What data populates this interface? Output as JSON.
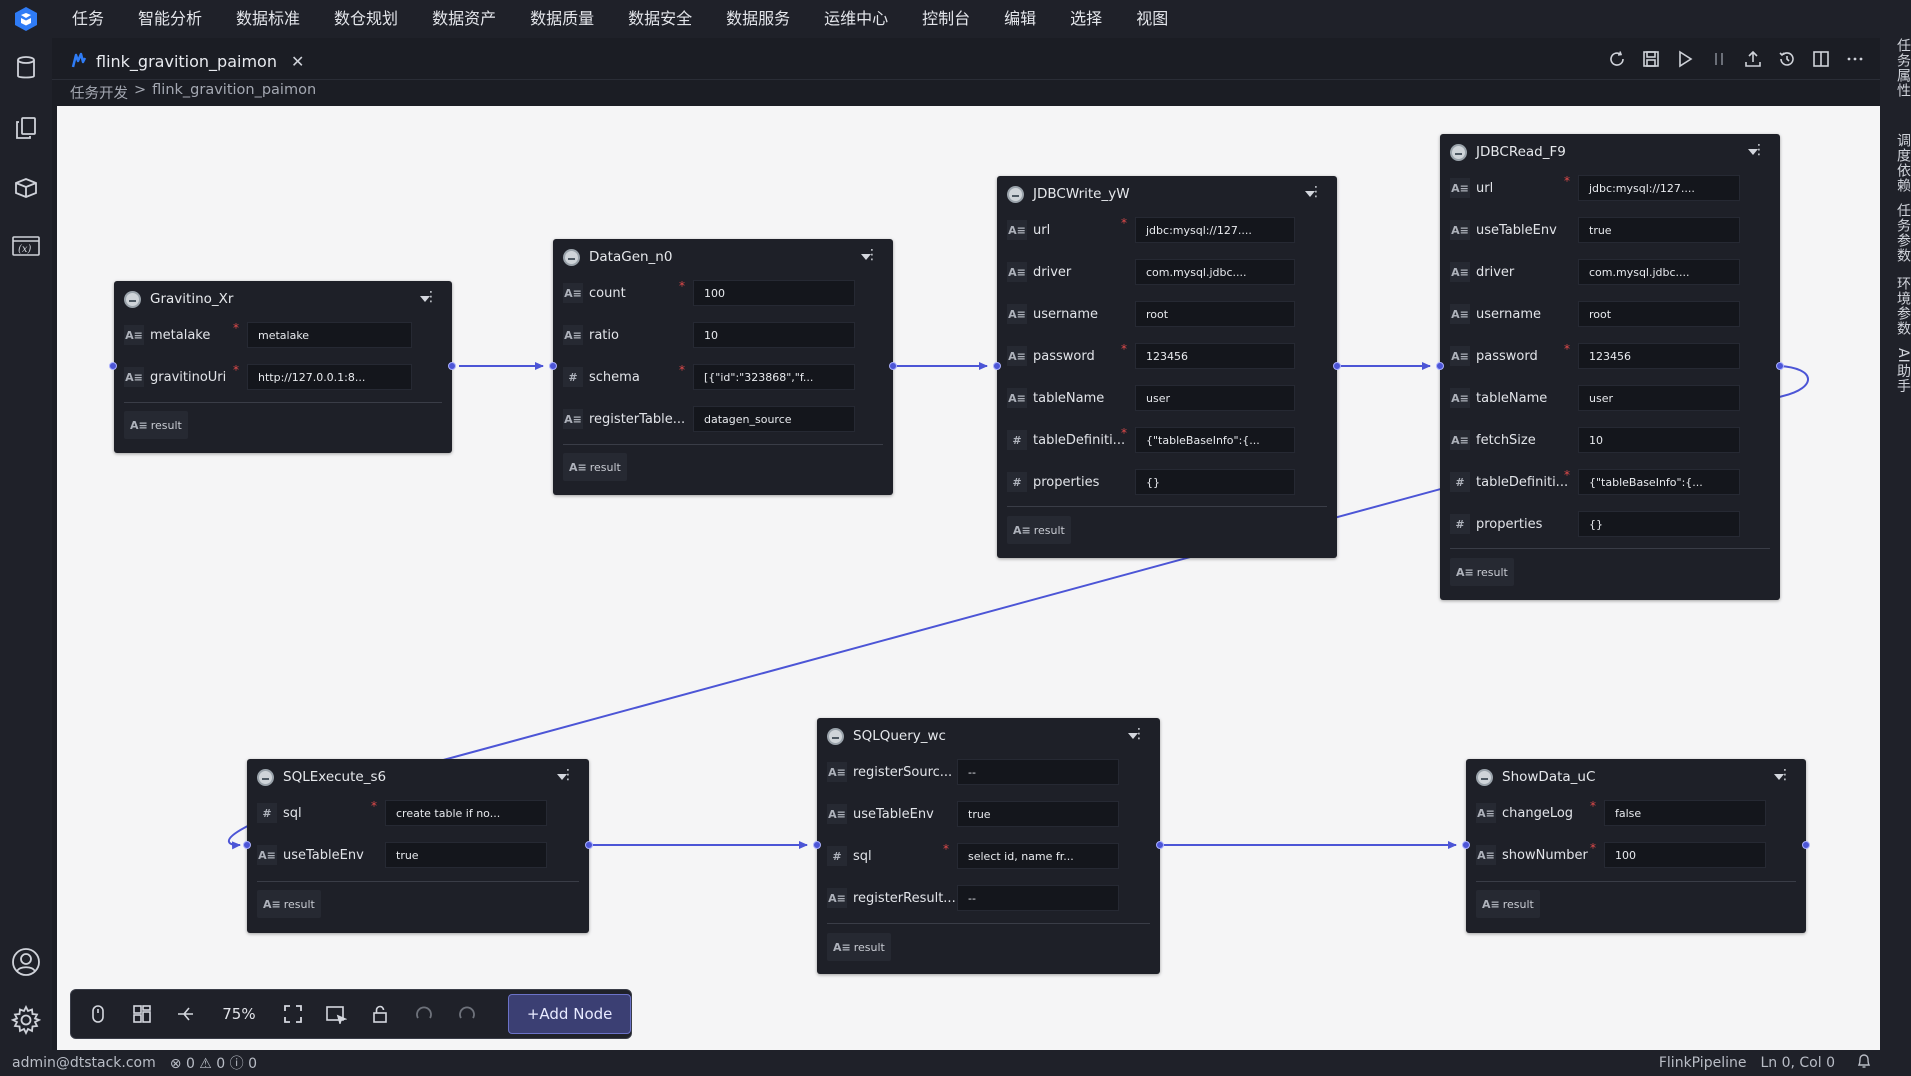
{
  "menubar": {
    "items": [
      "任务",
      "智能分析",
      "数据标准",
      "数仓规划",
      "数据资产",
      "数据质量",
      "数据安全",
      "数据服务",
      "运维中心",
      "控制台",
      "编辑",
      "选择",
      "视图"
    ]
  },
  "rightbar": {
    "items": [
      "任务属性",
      "调度依赖",
      "任务参数",
      "环境参数",
      "AI助手"
    ]
  },
  "tab": {
    "title": "flink_gravition_paimon",
    "close": "✕"
  },
  "breadcrumb": {
    "root": "任务开发",
    "separator": ">",
    "current": "flink_gravition_paimon"
  },
  "nodes": {
    "gravitino": {
      "title": "Gravitino_Xr",
      "fields": [
        {
          "type": "A≡",
          "label": "metalake",
          "value": "metalake",
          "required": true
        },
        {
          "type": "A≡",
          "label": "gravitinoUri",
          "value": "http://127.0.0.1:8...",
          "required": true
        }
      ],
      "result": "result"
    },
    "datagen": {
      "title": "DataGen_n0",
      "fields": [
        {
          "type": "A≡",
          "label": "count",
          "value": "100",
          "required": true
        },
        {
          "type": "A≡",
          "label": "ratio",
          "value": "10",
          "required": false
        },
        {
          "type": "#",
          "label": "schema",
          "value": "[{\"id\":\"323868\",\"f...",
          "required": true
        },
        {
          "type": "A≡",
          "label": "registerTable...",
          "value": "datagen_source",
          "required": false
        }
      ],
      "result": "result"
    },
    "jdbcwrite": {
      "title": "JDBCWrite_yW",
      "fields": [
        {
          "type": "A≡",
          "label": "url",
          "value": "jdbc:mysql://127....",
          "required": true
        },
        {
          "type": "A≡",
          "label": "driver",
          "value": "com.mysql.jdbc....",
          "required": false
        },
        {
          "type": "A≡",
          "label": "username",
          "value": "root",
          "required": false
        },
        {
          "type": "A≡",
          "label": "password",
          "value": "123456",
          "required": true
        },
        {
          "type": "A≡",
          "label": "tableName",
          "value": "user",
          "required": false
        },
        {
          "type": "#",
          "label": "tableDefiniti...",
          "value": "{\"tableBaseInfo\":{...",
          "required": true
        },
        {
          "type": "#",
          "label": "properties",
          "value": "{}",
          "required": false
        }
      ],
      "result": "result"
    },
    "jdbcread": {
      "title": "JDBCRead_F9",
      "fields": [
        {
          "type": "A≡",
          "label": "url",
          "value": "jdbc:mysql://127....",
          "required": true
        },
        {
          "type": "A≡",
          "label": "useTableEnv",
          "value": "true",
          "required": false
        },
        {
          "type": "A≡",
          "label": "driver",
          "value": "com.mysql.jdbc....",
          "required": false
        },
        {
          "type": "A≡",
          "label": "username",
          "value": "root",
          "required": false
        },
        {
          "type": "A≡",
          "label": "password",
          "value": "123456",
          "required": true
        },
        {
          "type": "A≡",
          "label": "tableName",
          "value": "user",
          "required": false
        },
        {
          "type": "A≡",
          "label": "fetchSize",
          "value": "10",
          "required": false
        },
        {
          "type": "#",
          "label": "tableDefiniti...",
          "value": "{\"tableBaseInfo\":{...",
          "required": true
        },
        {
          "type": "#",
          "label": "properties",
          "value": "{}",
          "required": false
        }
      ],
      "result": "result"
    },
    "sqlexecute": {
      "title": "SQLExecute_s6",
      "fields": [
        {
          "type": "#",
          "label": "sql",
          "value": "create table if no...",
          "required": true
        },
        {
          "type": "A≡",
          "label": "useTableEnv",
          "value": "true",
          "required": false
        }
      ],
      "result": "result"
    },
    "sqlquery": {
      "title": "SQLQuery_wc",
      "fields": [
        {
          "type": "A≡",
          "label": "registerSourc...",
          "value": "--",
          "required": false
        },
        {
          "type": "A≡",
          "label": "useTableEnv",
          "value": "true",
          "required": false
        },
        {
          "type": "#",
          "label": "sql",
          "value": "select id, name fr...",
          "required": true
        },
        {
          "type": "A≡",
          "label": "registerResult...",
          "value": "--",
          "required": false
        }
      ],
      "result": "result"
    },
    "showdata": {
      "title": "ShowData_uC",
      "fields": [
        {
          "type": "A≡",
          "label": "changeLog",
          "value": "false",
          "required": true
        },
        {
          "type": "A≡",
          "label": "showNumber",
          "value": "100",
          "required": true
        }
      ],
      "result": "result"
    }
  },
  "toolbar": {
    "zoom": "75%",
    "add_node": "+Add Node"
  },
  "statusbar": {
    "user": "admin@dtstack.com",
    "problems": "⊗ 0 ⚠ 0 ⓘ 0",
    "language": "FlinkPipeline",
    "position": "Ln 0, Col 0"
  },
  "colors": {
    "edge": "#4c55d6",
    "canvas": "#f5f5f6",
    "node_bg": "#1e2028",
    "accent": "#3b3f73"
  }
}
